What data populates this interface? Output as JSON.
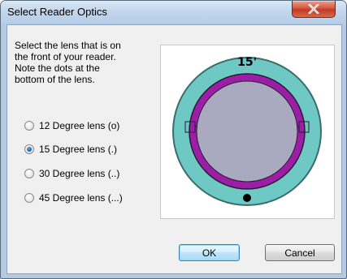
{
  "window": {
    "title": "Select Reader Optics"
  },
  "instructions": {
    "lines": [
      "Select the lens that is on",
      "the front of your reader.",
      "Note the dots at the",
      "bottom of the lens."
    ]
  },
  "lens_options": [
    {
      "label": "12 Degree lens (o)",
      "selected": false
    },
    {
      "label": "15 Degree lens (.)",
      "selected": true
    },
    {
      "label": "30 Degree lens (..)",
      "selected": false
    },
    {
      "label": "45 Degree lens (...)",
      "selected": false
    }
  ],
  "lens_diagram": {
    "label": "15'",
    "colors": {
      "outer_ring": "#6ec9c4",
      "inner_ring": "#9b1fa6",
      "lens_face": "#a9a9c0",
      "dot": "#000000"
    }
  },
  "buttons": {
    "ok": "OK",
    "cancel": "Cancel"
  },
  "colors": {
    "close_button": "#c8432c",
    "dialog_background": "#f0f0f0"
  }
}
